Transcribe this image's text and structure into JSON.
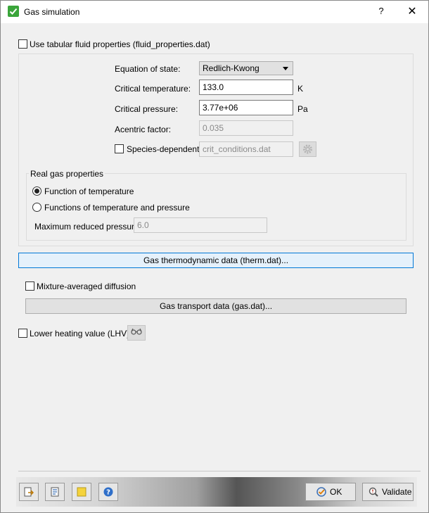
{
  "window": {
    "title": "Gas simulation",
    "help_label": "?",
    "close_label": "✕",
    "accent": "#3aa53a"
  },
  "tabular": {
    "label": "Use tabular fluid properties (fluid_properties.dat)",
    "checked": false
  },
  "eos": {
    "label": "Equation of state:",
    "value": "Redlich-Kwong"
  },
  "critical_temperature": {
    "label": "Critical temperature:",
    "value": "133.0",
    "unit": "K"
  },
  "critical_pressure": {
    "label": "Critical pressure:",
    "value": "3.77e+06",
    "unit": "Pa"
  },
  "acentric": {
    "label": "Acentric factor:",
    "value": "0.035"
  },
  "species": {
    "label": "Species-dependent",
    "file": "crit_conditions.dat",
    "checked": false
  },
  "real_gas": {
    "title": "Real gas properties",
    "option_temperature": "Function of temperature",
    "option_temperature_pressure": "Functions of temperature and pressure",
    "selected": "Function of temperature",
    "max_reduced_label": "Maximum reduced pressure:",
    "max_reduced_value": "6.0"
  },
  "therm_button": "Gas thermodynamic data (therm.dat)...",
  "mixture": {
    "label": "Mixture-averaged diffusion",
    "checked": false
  },
  "transport_button": "Gas transport data (gas.dat)...",
  "lhv": {
    "label": "Lower heating value (LHV)",
    "checked": false,
    "icon": "glasses-icon"
  },
  "footer": {
    "tools": [
      "export-icon",
      "import-icon",
      "note-icon",
      "help-icon"
    ],
    "ok_label": "OK",
    "validate_label": "Validate"
  }
}
